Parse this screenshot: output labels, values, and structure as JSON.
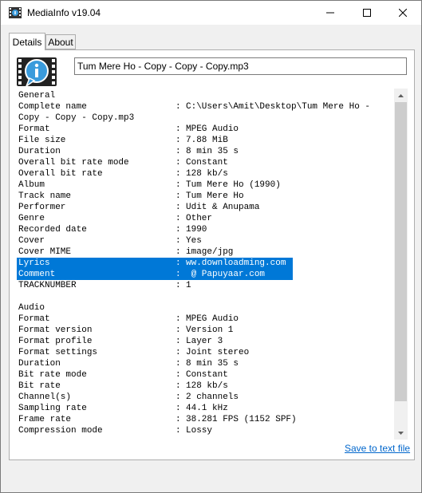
{
  "window": {
    "title": "MediaInfo v19.04"
  },
  "tabs": [
    {
      "label": "Details",
      "selected": true
    },
    {
      "label": "About",
      "selected": false
    }
  ],
  "file_field": {
    "value": "Tum Mere Ho - Copy - Copy - Copy.mp3"
  },
  "info_rows": [
    {
      "key": "General",
      "sep": "",
      "value": ""
    },
    {
      "key": "Complete name",
      "sep": ":",
      "value": "C:\\Users\\Amit\\Desktop\\Tum Mere Ho -"
    },
    {
      "key": "Copy - Copy - Copy.mp3",
      "sep": "",
      "value": ""
    },
    {
      "key": "Format",
      "sep": ":",
      "value": "MPEG Audio"
    },
    {
      "key": "File size",
      "sep": ":",
      "value": "7.88 MiB"
    },
    {
      "key": "Duration",
      "sep": ":",
      "value": "8 min 35 s"
    },
    {
      "key": "Overall bit rate mode",
      "sep": ":",
      "value": "Constant"
    },
    {
      "key": "Overall bit rate",
      "sep": ":",
      "value": "128 kb/s"
    },
    {
      "key": "Album",
      "sep": ":",
      "value": "Tum Mere Ho (1990)"
    },
    {
      "key": "Track name",
      "sep": ":",
      "value": "Tum Mere Ho"
    },
    {
      "key": "Performer",
      "sep": ":",
      "value": "Udit & Anupama"
    },
    {
      "key": "Genre",
      "sep": ":",
      "value": "Other"
    },
    {
      "key": "Recorded date",
      "sep": ":",
      "value": "1990"
    },
    {
      "key": "Cover",
      "sep": ":",
      "value": "Yes"
    },
    {
      "key": "Cover MIME",
      "sep": ":",
      "value": "image/jpg"
    },
    {
      "key": "Lyrics",
      "sep": ":",
      "value": "ww.downloadming.com",
      "selected": true
    },
    {
      "key": "Comment",
      "sep": ":",
      "value": " @ Papuyaar.com",
      "selected": true
    },
    {
      "key": "TRACKNUMBER",
      "sep": ":",
      "value": "1"
    },
    {
      "key": "",
      "sep": "",
      "value": ""
    },
    {
      "key": "Audio",
      "sep": "",
      "value": ""
    },
    {
      "key": "Format",
      "sep": ":",
      "value": "MPEG Audio"
    },
    {
      "key": "Format version",
      "sep": ":",
      "value": "Version 1"
    },
    {
      "key": "Format profile",
      "sep": ":",
      "value": "Layer 3"
    },
    {
      "key": "Format settings",
      "sep": ":",
      "value": "Joint stereo"
    },
    {
      "key": "Duration",
      "sep": ":",
      "value": "8 min 35 s"
    },
    {
      "key": "Bit rate mode",
      "sep": ":",
      "value": "Constant"
    },
    {
      "key": "Bit rate",
      "sep": ":",
      "value": "128 kb/s"
    },
    {
      "key": "Channel(s)",
      "sep": ":",
      "value": "2 channels"
    },
    {
      "key": "Sampling rate",
      "sep": ":",
      "value": "44.1 kHz"
    },
    {
      "key": "Frame rate",
      "sep": ":",
      "value": "38.281 FPS (1152 SPF)"
    },
    {
      "key": "Compression mode",
      "sep": ":",
      "value": "Lossy"
    }
  ],
  "save_link": {
    "label": "Save to text file"
  },
  "colors": {
    "selection": "#0078d7",
    "link": "#0066cc"
  },
  "icons": {
    "app": "mediainfo-app-icon",
    "logo": "mediainfo-logo-icon",
    "minimize": "minimize-icon",
    "maximize": "maximize-icon",
    "close": "close-icon",
    "scroll_up": "scroll-up-arrow-icon",
    "scroll_down": "scroll-down-arrow-icon"
  }
}
